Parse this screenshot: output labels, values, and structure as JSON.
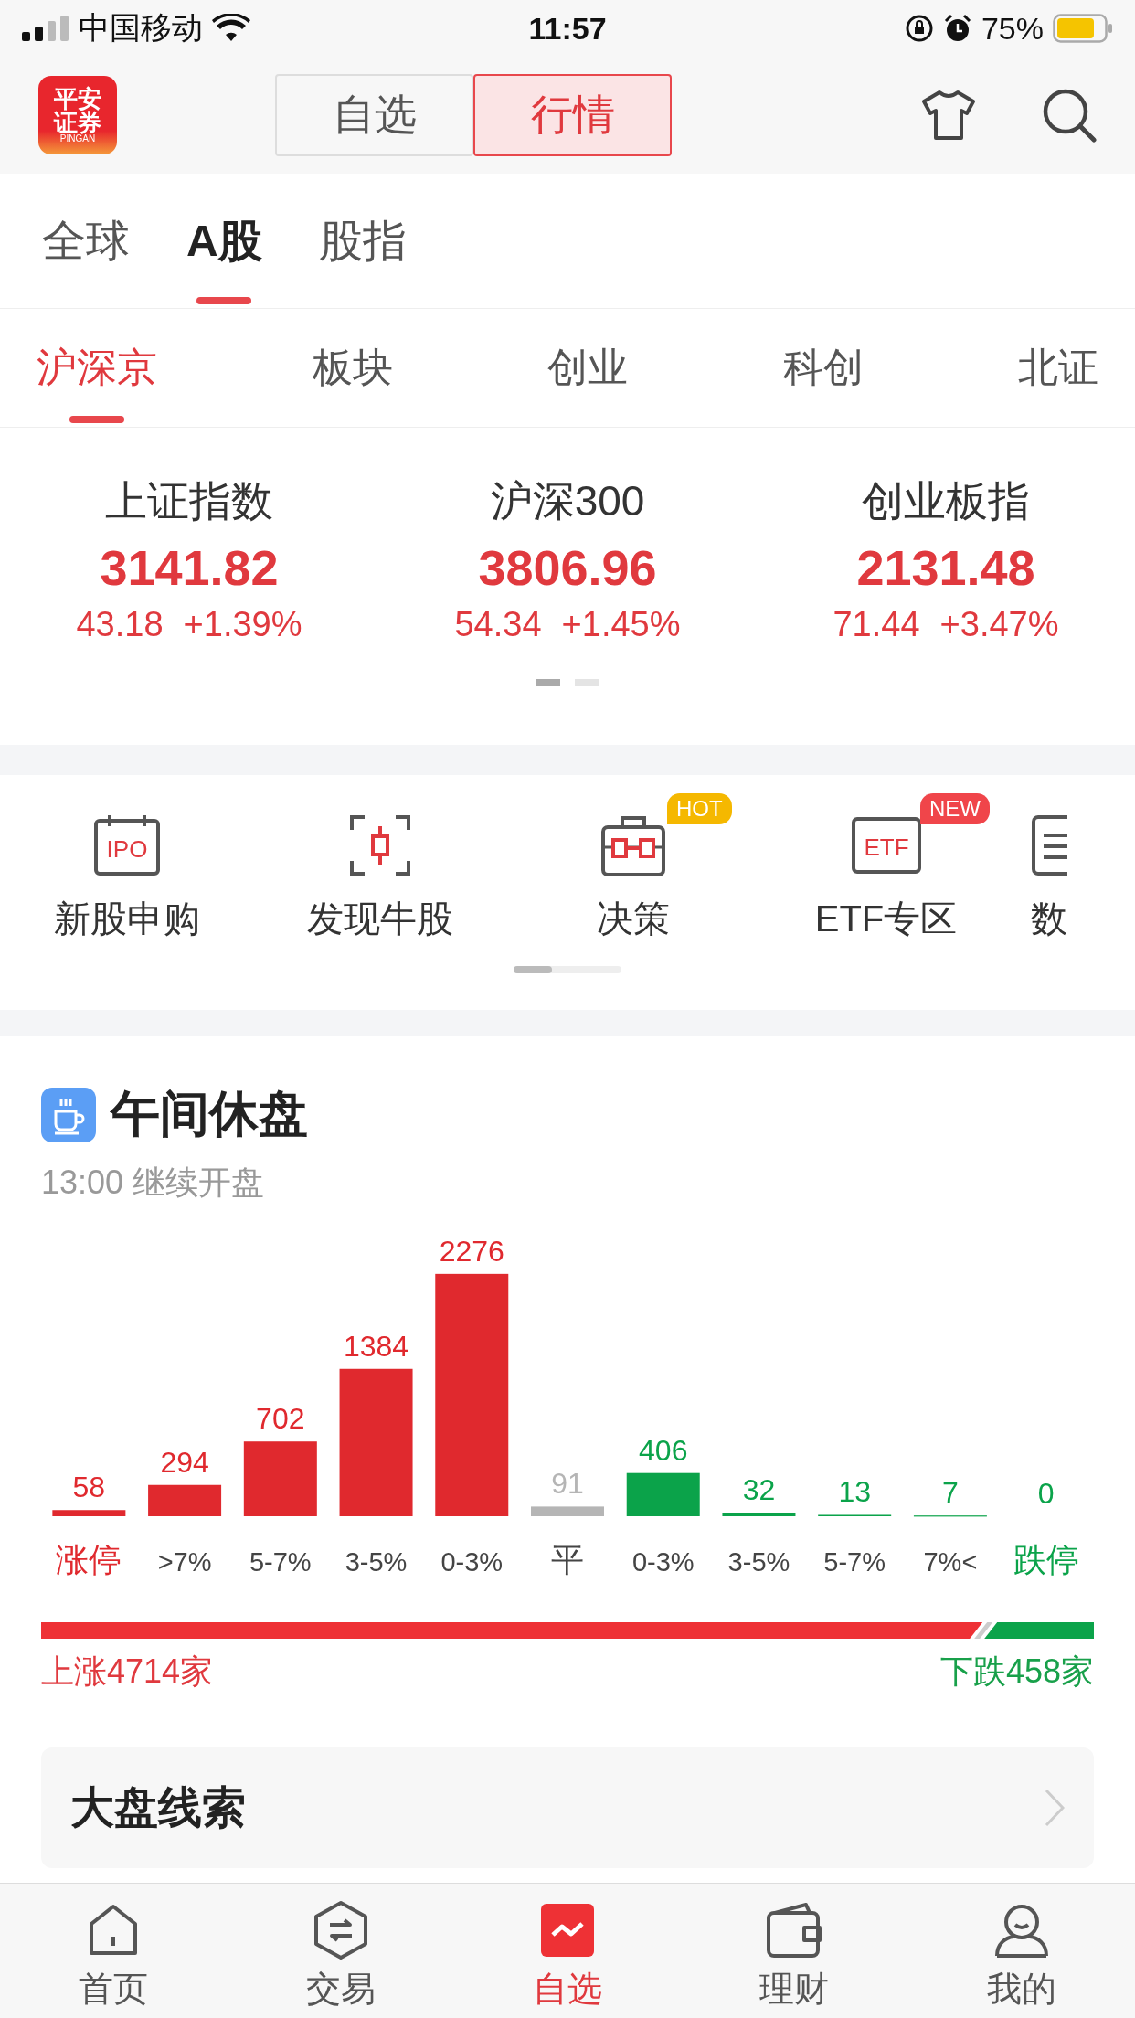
{
  "status_bar": {
    "carrier": "中国移动",
    "time": "11:57",
    "battery": "75%"
  },
  "header": {
    "logo": {
      "top": "平安",
      "bottom": "证券",
      "sub": "PINGAN"
    },
    "segments": [
      {
        "label": "自选",
        "selected": false
      },
      {
        "label": "行情",
        "selected": true
      }
    ]
  },
  "market_tabs": [
    {
      "label": "全球",
      "selected": false
    },
    {
      "label": "A股",
      "selected": true
    },
    {
      "label": "股指",
      "selected": false
    }
  ],
  "sub_tabs": [
    {
      "label": "沪深京",
      "selected": true
    },
    {
      "label": "板块",
      "selected": false
    },
    {
      "label": "创业",
      "selected": false
    },
    {
      "label": "科创",
      "selected": false
    },
    {
      "label": "北证",
      "selected": false
    }
  ],
  "indices": [
    {
      "name": "上证指数",
      "value": "3141.82",
      "change": "43.18",
      "percent": "+1.39%"
    },
    {
      "name": "沪深300",
      "value": "3806.96",
      "change": "54.34",
      "percent": "+1.45%"
    },
    {
      "name": "创业板指",
      "value": "2131.48",
      "change": "71.44",
      "percent": "+3.47%"
    }
  ],
  "index_pager": [
    {
      "selected": true
    },
    {
      "selected": false
    }
  ],
  "shortcuts": [
    {
      "kind": "ipo",
      "label": "新股申购",
      "icon_text": "IPO"
    },
    {
      "kind": "scan",
      "label": "发现牛股"
    },
    {
      "kind": "toolbox",
      "label": "决策",
      "badge": "HOT",
      "color": "#f5b800"
    },
    {
      "kind": "etf",
      "label": "ETF专区",
      "icon_text": "ETF",
      "badge": "NEW",
      "color": "#f0454a"
    },
    {
      "kind": "doc",
      "label": "数"
    }
  ],
  "breadth": {
    "title": "午间休盘",
    "subtitle": "13:00 继续开盘",
    "chart_data": {
      "type": "bar",
      "categories": [
        "涨停",
        ">7%",
        "5-7%",
        "3-5%",
        "0-3%",
        "平",
        "0-3%",
        "3-5%",
        "5-7%",
        "7%<",
        "跌停"
      ],
      "series": [
        {
          "color": "#e0292e",
          "values": [
            58,
            294,
            702,
            1384,
            2276,
            null,
            null,
            null,
            null,
            null,
            null
          ]
        },
        {
          "color": "#b5b5b5",
          "values": [
            null,
            null,
            null,
            null,
            null,
            91,
            null,
            null,
            null,
            null,
            null
          ]
        },
        {
          "color": "#0ba34a",
          "values": [
            null,
            null,
            null,
            null,
            null,
            null,
            406,
            32,
            13,
            7,
            0
          ]
        }
      ],
      "data_labels": true
    },
    "rise_share": {
      "level": 0.896
    },
    "up_label": "上涨4714家",
    "down_label": "下跌458家"
  },
  "card": {
    "title": "大盘线索"
  },
  "tab_bar": [
    {
      "kind": "home",
      "label": "首页",
      "selected": false
    },
    {
      "kind": "trade",
      "label": "交易",
      "selected": false
    },
    {
      "kind": "watch",
      "label": "自选",
      "selected": true
    },
    {
      "kind": "wallet",
      "label": "理财",
      "selected": false
    },
    {
      "kind": "user",
      "label": "我的",
      "selected": false
    }
  ]
}
